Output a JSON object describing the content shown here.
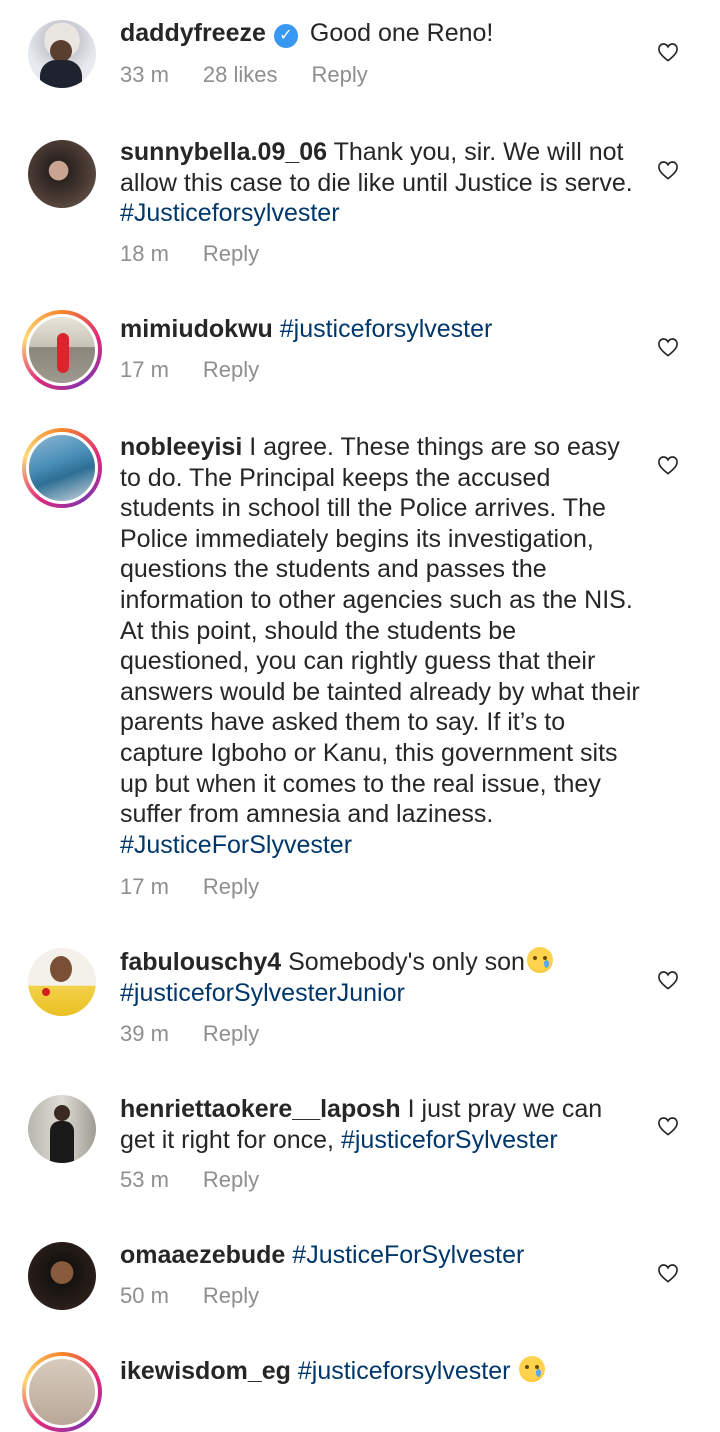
{
  "comments": [
    {
      "username": "daddyfreeze",
      "verified": true,
      "text": "Good one Reno!",
      "time": "33 m",
      "likes": "28 likes",
      "reply": "Reply",
      "avatar_color": "#d9dde3"
    },
    {
      "username": "sunnybella.09_06",
      "text": "Thank you, sir. We will not allow this case to die like until Justice is serve.",
      "hashtag": "#Justiceforsylvester",
      "time": "18 m",
      "reply": "Reply",
      "avatar_color": "#3a302c"
    },
    {
      "username": "mimiudokwu",
      "hashtag": "#justiceforsylvester",
      "time": "17 m",
      "reply": "Reply",
      "avatar_color": "#8c8a80"
    },
    {
      "username": "nobleeyisi",
      "text": "I agree. These things are so easy to do. The Principal keeps the accused students in school till the Police arrives. The Police immediately begins its investigation, questions the students and passes the information to other agencies such as the NIS. At this point, should the students be questioned, you can rightly guess that their answers would be tainted already by what their parents have asked them to say. If it’s to capture Igboho or Kanu, this government sits up but when it comes to the real issue, they suffer from amnesia and laziness.",
      "hashtag": "#JusticeForSlyvester",
      "time": "17 m",
      "reply": "Reply",
      "avatar_color": "#4a90b8"
    },
    {
      "username": "fabulouschy4",
      "text": "Somebody's only son",
      "emoji": "crying-face",
      "hashtag": "#justiceforSylvesterJunior",
      "time": "39 m",
      "reply": "Reply",
      "avatar_color": "#f3d24a"
    },
    {
      "username": "henriettaokere__laposh",
      "text": "I just pray we can get it right for once,",
      "hashtag": "#justiceforSylvester",
      "time": "53 m",
      "reply": "Reply",
      "avatar_color": "#7d7d75"
    },
    {
      "username": "omaaezebude",
      "hashtag": "#JusticeForSylvester",
      "time": "50 m",
      "reply": "Reply",
      "avatar_color": "#151210"
    },
    {
      "username": "ikewisdom_eg",
      "hashtag": "#justiceforsylvester",
      "emoji": "crying-face",
      "avatar_color": "#c9b8a8"
    }
  ],
  "icons": {
    "like": "heart-outline-icon",
    "verified": "verified-badge-icon"
  },
  "colors": {
    "hashtag": "#00376b",
    "meta": "#8e8e8e",
    "verified": "#3897f0"
  }
}
